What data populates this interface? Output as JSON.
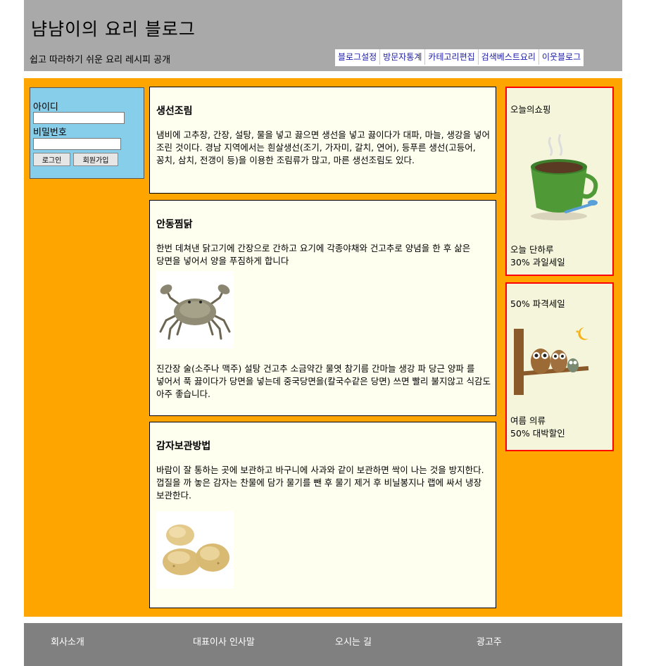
{
  "header": {
    "title": "냠냠이의 요리 블로그",
    "subtitle": "쉽고 따라하기 쉬운 요리 레시피 공개",
    "nav": [
      "블로그설정",
      "방문자통계",
      "카테고리편집",
      "검색베스트요리",
      "이웃블로그"
    ]
  },
  "login": {
    "id_label": "아이디",
    "pw_label": "비밀번호",
    "login_button": "로그인",
    "join_button": "회원가입"
  },
  "posts": [
    {
      "title": "생선조림",
      "body": "냄비에 고추장, 간장, 설탕, 물을 넣고 끓으면 생선을 넣고 끓이다가 대파, 마늘, 생강을 넣어 조린 것이다. 경남 지역에서는 흰살생선(조기, 가자미, 갈치, 연어), 등푸른 생선(고등어, 꽁치, 삼치, 전갱이 등)을 이용한 조림류가 많고, 마른 생선조림도 있다."
    },
    {
      "title": "안동찜닭",
      "body": "한번 데쳐낸 닭고기에 간장으로 간하고 요기에 각종야채와 건고추로 양념을 한 후 삶은 당면을 넣어서 양을 푸짐하게 합니다",
      "image": "crab-photo",
      "body2": "진간장 술(소주나 맥주) 설탕 건고추 소금약간 물엿 참기름 간마늘 생강 파 당근 양파 를 넣어서 푹 끓이다가 당면을 넣는데 중국당면을(칼국수같은 당면) 쓰면 빨리 불지않고 식감도 아주 좋습니다."
    },
    {
      "title": "감자보관방법",
      "body": "바람이 잘 통하는 곳에 보관하고 바구니에 사과와 같이 보관하면 싹이 나는 것을 방지한다. 껍질을 까 놓은 감자는 찬물에 담가 물기를 뺀 후 물기 제거 후 비닐봉지나 랩에 싸서 냉장 보관한다.",
      "image": "potato-photo"
    }
  ],
  "ads": [
    {
      "title": "오늘의쇼핑",
      "image": "coffee-cup-image",
      "line1": "오늘 단하루",
      "line2": "30% 과일세일"
    },
    {
      "title": "50% 파격세일",
      "image": "owls-on-branch-image",
      "line1": "여름 의류",
      "line2": "50% 대박할인"
    }
  ],
  "footer": {
    "links": [
      "회사소개",
      "대표이사 인사말",
      "오시는 길",
      "광고주"
    ]
  },
  "colors": {
    "header_bg": "#a9a9a9",
    "main_bg": "#ffa500",
    "login_bg": "#87ceeb",
    "post_bg": "#fffff0",
    "ad_bg": "#f5f5dc",
    "ad_border": "#ff0000",
    "footer_bg": "#808080"
  }
}
